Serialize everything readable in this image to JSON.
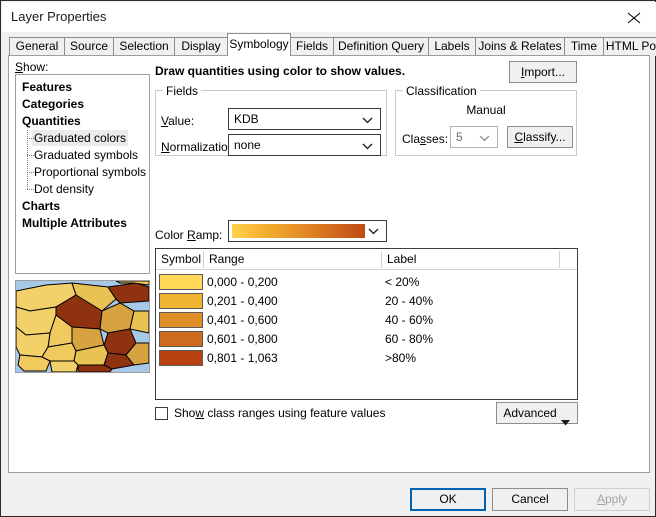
{
  "window": {
    "title": "Layer Properties",
    "close_icon": "close-icon"
  },
  "tabs": [
    {
      "label": "General",
      "active": false
    },
    {
      "label": "Source",
      "active": false
    },
    {
      "label": "Selection",
      "active": false
    },
    {
      "label": "Display",
      "active": false
    },
    {
      "label": "Symbology",
      "active": true
    },
    {
      "label": "Fields",
      "active": false
    },
    {
      "label": "Definition Query",
      "active": false
    },
    {
      "label": "Labels",
      "active": false
    },
    {
      "label": "Joins & Relates",
      "active": false
    },
    {
      "label": "Time",
      "active": false
    },
    {
      "label": "HTML Popup",
      "active": false
    }
  ],
  "sidebar": {
    "show_label": "Show:",
    "items": [
      {
        "label": "Features",
        "level": 0,
        "bold": true,
        "selected": false
      },
      {
        "label": "Categories",
        "level": 0,
        "bold": true,
        "selected": false
      },
      {
        "label": "Quantities",
        "level": 0,
        "bold": true,
        "selected": false
      },
      {
        "label": "Graduated colors",
        "level": 1,
        "bold": false,
        "selected": true
      },
      {
        "label": "Graduated symbols",
        "level": 1,
        "bold": false,
        "selected": false
      },
      {
        "label": "Proportional symbols",
        "level": 1,
        "bold": false,
        "selected": false
      },
      {
        "label": "Dot density",
        "level": 1,
        "bold": false,
        "selected": false
      },
      {
        "label": "Charts",
        "level": 0,
        "bold": true,
        "selected": false
      },
      {
        "label": "Multiple Attributes",
        "level": 0,
        "bold": true,
        "selected": false
      }
    ]
  },
  "preview": {
    "name": "map-preview-thumbnail",
    "ocean_color": "#a8c8e8",
    "outline_color": "#000000"
  },
  "main": {
    "heading": "Draw quantities using color to show values.",
    "import_label": "Import...",
    "fields": {
      "group_title": "Fields",
      "value_label": "Value:",
      "value_selected": "KDB",
      "normalization_label": "Normalization:",
      "normalization_selected": "none"
    },
    "classification": {
      "group_title": "Classification",
      "method": "Manual",
      "classes_label": "Classes:",
      "classes_value": "5",
      "classify_label": "Classify..."
    },
    "color_ramp": {
      "label": "Color Ramp:",
      "start_color": "#ffd24d",
      "end_color": "#bf4a15"
    },
    "table": {
      "columns": [
        "Symbol",
        "Range",
        "Label"
      ],
      "rows": [
        {
          "color": "#ffd955",
          "range": "0,000 - 0,200",
          "label": "< 20%"
        },
        {
          "color": "#f0b431",
          "range": "0,201 - 0,400",
          "label": "20 - 40%"
        },
        {
          "color": "#e08f26",
          "range": "0,401 - 0,600",
          "label": "40 - 60%"
        },
        {
          "color": "#cf6b1c",
          "range": "0,601 - 0,800",
          "label": "60 - 80%"
        },
        {
          "color": "#b74311",
          "range": "0,801 - 1,063",
          "label": ">80%"
        }
      ]
    },
    "show_class_ranges_label": "Show class ranges using feature values",
    "show_class_ranges_checked": false,
    "advanced_label": "Advanced"
  },
  "footer": {
    "ok_label": "OK",
    "cancel_label": "Cancel",
    "apply_label": "Apply",
    "apply_disabled": true
  }
}
